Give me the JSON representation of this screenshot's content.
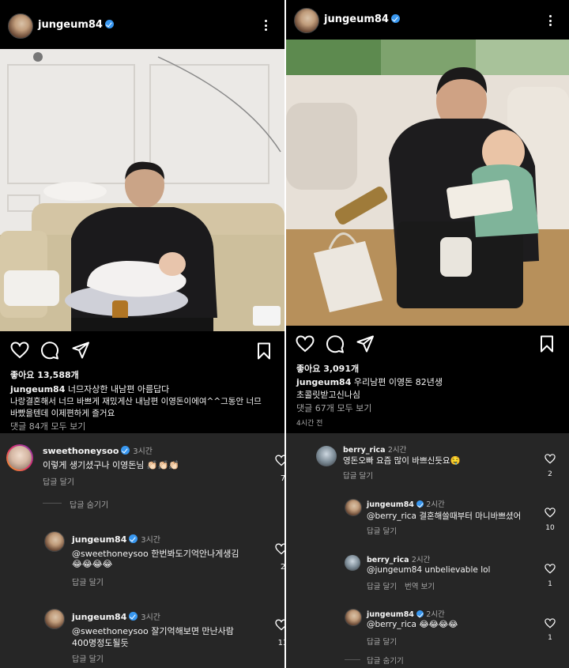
{
  "left_post": {
    "username": "jungeum84",
    "likes": "좋아요 13,588개",
    "caption_user": "jungeum84",
    "caption_line1": "너므자상한 내남편 아름답다",
    "caption_line2": "나랑결혼해서 너므 바쁘게 재밌게산 내남편 이영돈이에여^^그동안 너므",
    "caption_line3": "바빴을텐데 이제편하게 즐거요",
    "view_comments": "댓글 84개 모두 보기"
  },
  "right_post": {
    "username": "jungeum84",
    "likes": "좋아요 3,091개",
    "caption_user": "jungeum84",
    "caption_line1": "우리남편 이영돈 82년생",
    "caption_line2": "초콜릿받고신나심",
    "view_comments": "댓글 67개 모두 보기",
    "time": "4시간 전"
  },
  "left_comments": [
    {
      "user": "sweethoneysoo",
      "time": "3시간",
      "text": "이렇게 생기셨구나 이영돈님 👏🏻👏🏻👏🏻",
      "reply": "답글 달기",
      "likes": "7",
      "hide": "답글 숨기기"
    },
    {
      "user": "jungeum84",
      "time": "3시간",
      "text1": "@sweethoneysoo 한번봐도기억안나게생김",
      "text2": "😂😂😂😂",
      "reply": "답글 달기",
      "likes": "2"
    },
    {
      "user": "jungeum84",
      "time": "3시간",
      "text1": "@sweethoneysoo 잘기억해보면 만난사람",
      "text2": "400명정도될듯",
      "reply": "답글 달기",
      "likes": "13"
    }
  ],
  "right_comments": [
    {
      "user": "berry_rica",
      "time": "2시간",
      "text": "영돈오빠 요즘 많이 바쁘신듯요🤤",
      "reply": "답글 달기",
      "likes": "2"
    },
    {
      "user": "jungeum84",
      "time": "2시간",
      "text": "@berry_rica 결혼해쓸때부터 마니바쁘셨어",
      "reply": "답글 달기",
      "likes": "10"
    },
    {
      "user": "berry_rica",
      "time": "2시간",
      "text": "@jungeum84 unbelievable lol",
      "reply": "답글 달기",
      "translate": "번역 보기",
      "likes": "1"
    },
    {
      "user": "jungeum84",
      "time": "2시간",
      "text": "@berry_rica 😂😂😂😂",
      "reply": "답글 달기",
      "likes": "1",
      "hide": "답글 숨기기"
    }
  ],
  "colors": {
    "background": "#000000",
    "comments_bg": "#262626",
    "verified": "#3897f0",
    "muted": "#a8a8a8"
  }
}
